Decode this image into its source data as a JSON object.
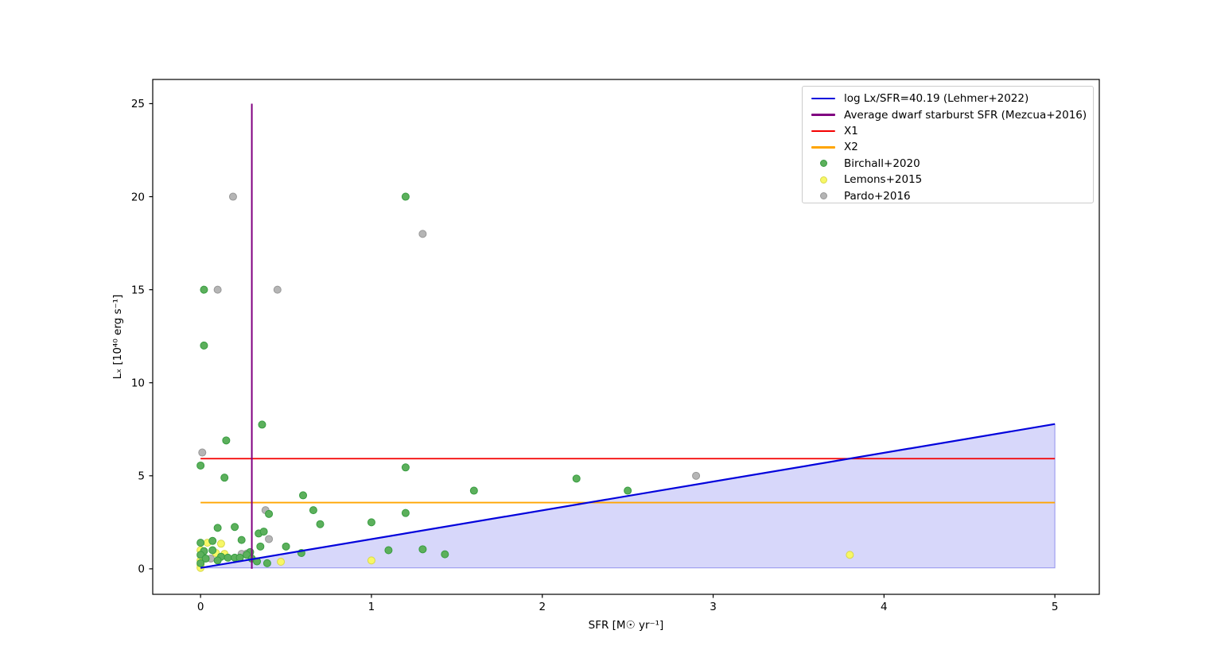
{
  "figure": {
    "background": "#ffffff"
  },
  "chart_data": {
    "type": "scatter",
    "title": "",
    "xlabel": "SFR [M☉ yr⁻¹]",
    "ylabel": "Lₓ [10⁴⁰ erg s⁻¹]",
    "xlim": [
      -0.28,
      5.26
    ],
    "ylim": [
      -1.37,
      26.3
    ],
    "x_ticks": [
      0,
      1,
      2,
      3,
      4,
      5
    ],
    "y_ticks": [
      0,
      5,
      10,
      15,
      20,
      25
    ],
    "grid": false,
    "legend_position": "upper right",
    "axis_color": "#000000",
    "fill": {
      "polygon": [
        [
          0,
          0.05
        ],
        [
          5,
          7.78
        ],
        [
          5,
          0.05
        ]
      ],
      "color": "rgba(55,55,230,0.20)",
      "edge_color": "rgba(40,40,220,0.45)"
    },
    "lines": [
      {
        "label": "log Lx/SFR=40.19 (Lehmer+2022)",
        "color": "#0202dc",
        "width": 2.2,
        "x": [
          0,
          5
        ],
        "y": [
          0.05,
          7.78
        ]
      },
      {
        "label": "Average dwarf starburst SFR (Mezcua+2016)",
        "color": "#800080",
        "width": 2.0,
        "x": [
          0.3,
          0.3
        ],
        "y": [
          0,
          25
        ]
      },
      {
        "label": "X1",
        "color": "#f40000",
        "width": 1.8,
        "x": [
          0,
          5
        ],
        "y": [
          5.92,
          5.92
        ]
      },
      {
        "label": "X2",
        "color": "#ffa500",
        "width": 1.8,
        "x": [
          0,
          5
        ],
        "y": [
          3.56,
          3.56
        ]
      }
    ],
    "series": [
      {
        "name": "Birchall+2020",
        "color": "#5cb05c",
        "edge_color": "#379c40",
        "points": [
          [
            0.02,
            15
          ],
          [
            1.2,
            20
          ],
          [
            0.02,
            12
          ],
          [
            0.36,
            7.75
          ],
          [
            0.15,
            6.9
          ],
          [
            0.0,
            5.55
          ],
          [
            0.14,
            4.9
          ],
          [
            1.2,
            5.45
          ],
          [
            2.2,
            4.85
          ],
          [
            2.5,
            4.2
          ],
          [
            1.6,
            4.2
          ],
          [
            0.6,
            3.95
          ],
          [
            0.66,
            3.15
          ],
          [
            0.4,
            2.95
          ],
          [
            1.2,
            3.0
          ],
          [
            0.7,
            2.4
          ],
          [
            1.0,
            2.5
          ],
          [
            0.1,
            2.2
          ],
          [
            0.2,
            2.25
          ],
          [
            0.34,
            1.9
          ],
          [
            0.37,
            2.0
          ],
          [
            0.24,
            1.55
          ],
          [
            0.0,
            1.4
          ],
          [
            0.07,
            1.5
          ],
          [
            0.35,
            1.2
          ],
          [
            0.5,
            1.2
          ],
          [
            0.29,
            0.9
          ],
          [
            0.59,
            0.85
          ],
          [
            0.02,
            0.95
          ],
          [
            0.07,
            1.0
          ],
          [
            0.0,
            0.75
          ],
          [
            0.03,
            0.55
          ],
          [
            0.12,
            0.65
          ],
          [
            0.16,
            0.6
          ],
          [
            0.2,
            0.6
          ],
          [
            0.23,
            0.6
          ],
          [
            0.27,
            0.75
          ],
          [
            0.3,
            0.55
          ],
          [
            0.33,
            0.4
          ],
          [
            0.39,
            0.3
          ],
          [
            0.1,
            0.45
          ],
          [
            1.1,
            1.0
          ],
          [
            1.3,
            1.05
          ],
          [
            1.43,
            0.78
          ],
          [
            0.0,
            0.3
          ]
        ]
      },
      {
        "name": "Lemons+2015",
        "color": "#f7f766",
        "edge_color": "#d8d84a",
        "points": [
          [
            0.04,
            1.4
          ],
          [
            0.12,
            1.35
          ],
          [
            0.09,
            0.85
          ],
          [
            0.0,
            1.0
          ],
          [
            0.14,
            0.8
          ],
          [
            0.0,
            0.45
          ],
          [
            0.0,
            0.2
          ],
          [
            0.0,
            0.05
          ],
          [
            0.47,
            0.38
          ],
          [
            1.0,
            0.45
          ],
          [
            3.8,
            0.75
          ]
        ]
      },
      {
        "name": "Pardo+2016",
        "color": "#b5b5b5",
        "edge_color": "#979797",
        "points": [
          [
            0.19,
            20
          ],
          [
            1.3,
            18
          ],
          [
            0.1,
            15
          ],
          [
            0.45,
            15
          ],
          [
            0.01,
            6.25
          ],
          [
            2.9,
            5.0
          ],
          [
            0.38,
            3.15
          ],
          [
            0.4,
            1.6
          ],
          [
            0.24,
            0.8
          ],
          [
            0.27,
            0.82
          ],
          [
            0.06,
            0.55
          ]
        ]
      }
    ]
  }
}
